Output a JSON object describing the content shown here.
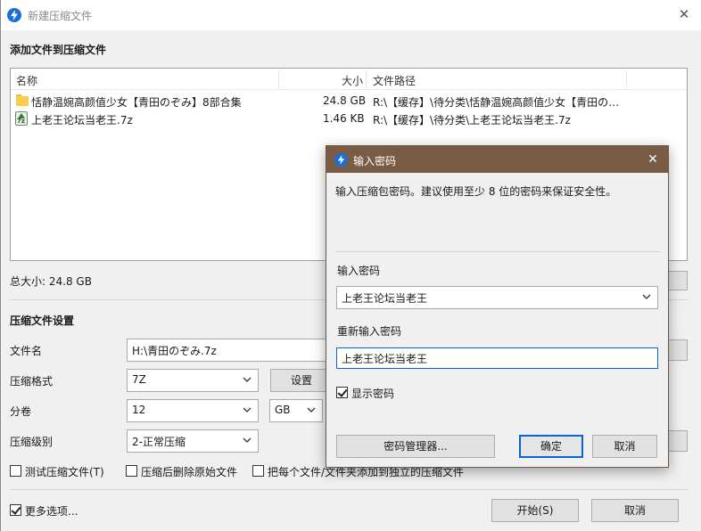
{
  "main": {
    "title": "新建压缩文件",
    "add_section_title": "添加文件到压缩文件",
    "columns": {
      "name": "名称",
      "size": "大小",
      "path": "文件路径"
    },
    "files": [
      {
        "name": "恬静温婉高颜值少女【青田のぞみ】8部合集",
        "size": "24.8 GB",
        "path": "R:\\【缓存】\\待分类\\恬静温婉高颜值少女【青田の…",
        "icon": "folder-icon"
      },
      {
        "name": "上老王论坛当老王.7z",
        "size": "1.46 KB",
        "path": "R:\\【缓存】\\待分类\\上老王论坛当老王.7z",
        "icon": "7z-archive-icon"
      }
    ],
    "total_size": "总大小: 24.8 GB",
    "settings_title": "压缩文件设置",
    "filename_label": "文件名",
    "filename_value": "H:\\青田のぞみ.7z",
    "format_label": "压缩格式",
    "format_value": "7Z",
    "settings_button": "设置",
    "volume_label": "分卷",
    "volume_value": "12",
    "volume_unit": "GB",
    "level_label": "压缩级别",
    "level_value": "2-正常压缩",
    "test_archive": "测试压缩文件(T)",
    "delete_after": "压缩后删除原始文件",
    "each_separate": "把每个文件/文件夹添加到独立的压缩文件",
    "more_options": "更多选项...",
    "start_button": "开始(S)",
    "cancel_button": "取消"
  },
  "dialog": {
    "title": "输入密码",
    "description": "输入压缩包密码。建议使用至少 8 位的密码来保证安全性。",
    "password_label": "输入密码",
    "password_value": "上老王论坛当老王",
    "reenter_label": "重新输入密码",
    "reenter_value": "上老王论坛当老王",
    "show_password": "显示密码",
    "manager_button": "密码管理器...",
    "ok_button": "确定",
    "cancel_button": "取消"
  },
  "colors": {
    "dialog_titlebar": "#7a5c45",
    "focus_blue": "#0a64d3",
    "app_icon": "#1a6fd6"
  }
}
